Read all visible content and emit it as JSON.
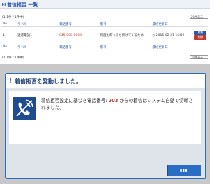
{
  "list": {
    "title": "着信拒否 一覧",
    "range_text": "(1-1件 / 1件中)",
    "per_page": "20件表示",
    "columns": [
      "No",
      "ラベル",
      "電話番号",
      "備考",
      "最終更新日"
    ],
    "rows": [
      {
        "no": "1",
        "label": "迷惑電話1",
        "phone": "045-000-0000",
        "note": "何度も断っても掛けてくるため",
        "updated": "2015-02-21 16:02"
      }
    ],
    "edit_label": "編集",
    "delete_label": "削除"
  },
  "modal": {
    "title": "着信拒否を発動しました。",
    "message_before": "着信拒否設定に基づき電話番号: ",
    "number": "203",
    "message_after": " からの着信はシステム自動で切断されました。",
    "ok_label": "OK"
  },
  "colors": {
    "accent": "#2a6dc4",
    "warning": "#c0392b"
  },
  "icons": [
    "dot-icon",
    "exclamation-icon",
    "phone-blocked-icon",
    "clock-icon"
  ]
}
